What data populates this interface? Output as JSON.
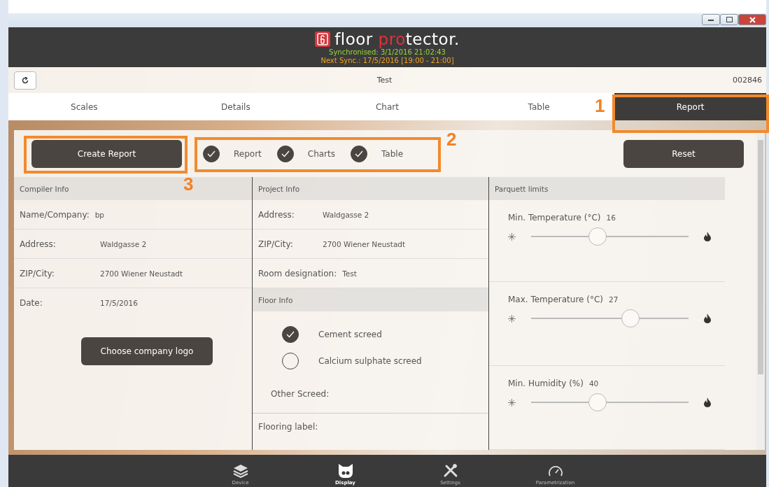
{
  "brand": {
    "first_word": "floor",
    "accent": "pro",
    "rest": "tector."
  },
  "sync": {
    "synchronised": "Synchronised: 3/1/2016 21:02:43",
    "next": "Next Sync.: 17/5/2016 [19:00 - 21:00]"
  },
  "toolbar": {
    "title": "Test",
    "serial": "002846"
  },
  "tabs": [
    {
      "label": "Scales",
      "selected": false
    },
    {
      "label": "Details",
      "selected": false
    },
    {
      "label": "Chart",
      "selected": false
    },
    {
      "label": "Table",
      "selected": false
    },
    {
      "label": "Report",
      "selected": true
    }
  ],
  "create_button": "Create Report",
  "report_options": [
    {
      "label": "Report",
      "checked": true
    },
    {
      "label": "Charts",
      "checked": true
    },
    {
      "label": "Table",
      "checked": true
    }
  ],
  "reset_button": "Reset",
  "compiler_info": {
    "title": "Compiler Info",
    "rows": [
      {
        "label": "Name/Company:",
        "value": "bp"
      },
      {
        "label": "Address:",
        "value": "Waldgasse 2"
      },
      {
        "label": "ZIP/City:",
        "value": "2700 Wiener Neustadt"
      },
      {
        "label": "Date:",
        "value": "17/5/2016"
      }
    ],
    "logo_button": "Choose company logo"
  },
  "project_info": {
    "title": "Project Info",
    "rows": [
      {
        "label": "Address:",
        "value": "Waldgasse 2"
      },
      {
        "label": "ZIP/City:",
        "value": "2700 Wiener Neustadt"
      },
      {
        "label": "Room designation:",
        "value": "Test"
      }
    ]
  },
  "floor_info": {
    "title": "Floor Info",
    "screeds": [
      {
        "label": "Cement screed",
        "selected": true
      },
      {
        "label": "Calcium sulphate screed",
        "selected": false
      }
    ],
    "other_label": "Other Screed:",
    "flooring_label": "Flooring label:"
  },
  "parquett_limits": {
    "title": "Parquett limits",
    "sliders": [
      {
        "label": "Min. Temperature (°C)",
        "reading": "16",
        "level": 0.41
      },
      {
        "label": "Max. Temperature (°C)",
        "reading": "27",
        "level": 0.65
      },
      {
        "label": "Min. Humidity (%)",
        "reading": "40",
        "level": 0.41
      }
    ]
  },
  "bottom_nav": [
    {
      "label": "Device",
      "kind": "layers",
      "selected": false
    },
    {
      "label": "Display",
      "kind": "cat",
      "selected": true
    },
    {
      "label": "Settings",
      "kind": "tools",
      "selected": false
    },
    {
      "label": "Parametrization",
      "kind": "gauge",
      "selected": false
    }
  ],
  "annotations": [
    "1",
    "2",
    "3"
  ]
}
